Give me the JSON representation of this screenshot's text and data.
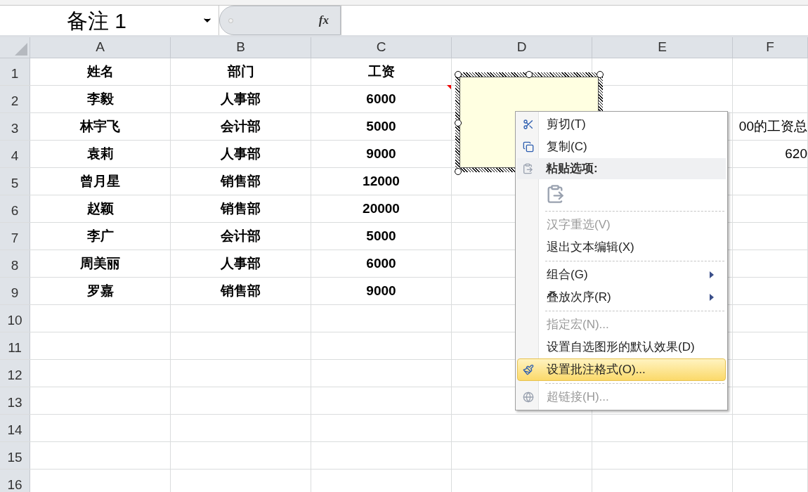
{
  "name_box": {
    "value": "备注 1"
  },
  "formula_bar": {
    "fx": "fx"
  },
  "columns": [
    "A",
    "B",
    "C",
    "D",
    "E",
    "F"
  ],
  "rows": [
    {
      "number": "1",
      "cells": [
        "姓名",
        "部门",
        "工资",
        "",
        "",
        ""
      ]
    },
    {
      "number": "2",
      "cells": [
        "李毅",
        "人事部",
        "6000",
        "",
        "",
        ""
      ]
    },
    {
      "number": "3",
      "cells": [
        "林宇飞",
        "会计部",
        "5000",
        "",
        "",
        "00的工资总"
      ]
    },
    {
      "number": "4",
      "cells": [
        "袁莉",
        "人事部",
        "9000",
        "",
        "",
        "620"
      ]
    },
    {
      "number": "5",
      "cells": [
        "曾月星",
        "销售部",
        "12000",
        "",
        "",
        ""
      ]
    },
    {
      "number": "6",
      "cells": [
        "赵颖",
        "销售部",
        "20000",
        "",
        "",
        ""
      ]
    },
    {
      "number": "7",
      "cells": [
        "李广",
        "会计部",
        "5000",
        "",
        "",
        ""
      ]
    },
    {
      "number": "8",
      "cells": [
        "周美丽",
        "人事部",
        "6000",
        "",
        "",
        ""
      ]
    },
    {
      "number": "9",
      "cells": [
        "罗嘉",
        "销售部",
        "9000",
        "",
        "",
        ""
      ]
    },
    {
      "number": "10",
      "cells": [
        "",
        "",
        "",
        "",
        "",
        ""
      ]
    },
    {
      "number": "11",
      "cells": [
        "",
        "",
        "",
        "",
        "",
        ""
      ]
    },
    {
      "number": "12",
      "cells": [
        "",
        "",
        "",
        "",
        "",
        ""
      ]
    },
    {
      "number": "13",
      "cells": [
        "",
        "",
        "",
        "",
        "",
        ""
      ]
    },
    {
      "number": "14",
      "cells": [
        "",
        "",
        "",
        "",
        "",
        ""
      ]
    },
    {
      "number": "15",
      "cells": [
        "",
        "",
        "",
        "",
        "",
        ""
      ]
    },
    {
      "number": "16",
      "cells": [
        "",
        "",
        "",
        "",
        "",
        ""
      ]
    }
  ],
  "context_menu": [
    {
      "kind": "item",
      "label": "剪切(T)",
      "disabled": false,
      "selected": false,
      "submenu": false
    },
    {
      "kind": "item",
      "label": "复制(C)",
      "disabled": false,
      "selected": false,
      "submenu": false
    },
    {
      "kind": "header",
      "label": "粘贴选项:"
    },
    {
      "kind": "paste-options"
    },
    {
      "kind": "separator"
    },
    {
      "kind": "item",
      "label": "汉字重选(V)",
      "disabled": true,
      "selected": false,
      "submenu": false
    },
    {
      "kind": "item",
      "label": "退出文本编辑(X)",
      "disabled": false,
      "selected": false,
      "submenu": false
    },
    {
      "kind": "separator"
    },
    {
      "kind": "item",
      "label": "组合(G)",
      "disabled": false,
      "selected": false,
      "submenu": true
    },
    {
      "kind": "item",
      "label": "叠放次序(R)",
      "disabled": false,
      "selected": false,
      "submenu": true
    },
    {
      "kind": "separator"
    },
    {
      "kind": "item",
      "label": "指定宏(N)...",
      "disabled": true,
      "selected": false,
      "submenu": false
    },
    {
      "kind": "item",
      "label": "设置自选图形的默认效果(D)",
      "disabled": false,
      "selected": false,
      "submenu": false
    },
    {
      "kind": "item",
      "label": "设置批注格式(O)...",
      "disabled": false,
      "selected": true,
      "submenu": false
    },
    {
      "kind": "separator"
    },
    {
      "kind": "item",
      "label": "超链接(H)...",
      "disabled": true,
      "selected": false,
      "submenu": false
    }
  ]
}
